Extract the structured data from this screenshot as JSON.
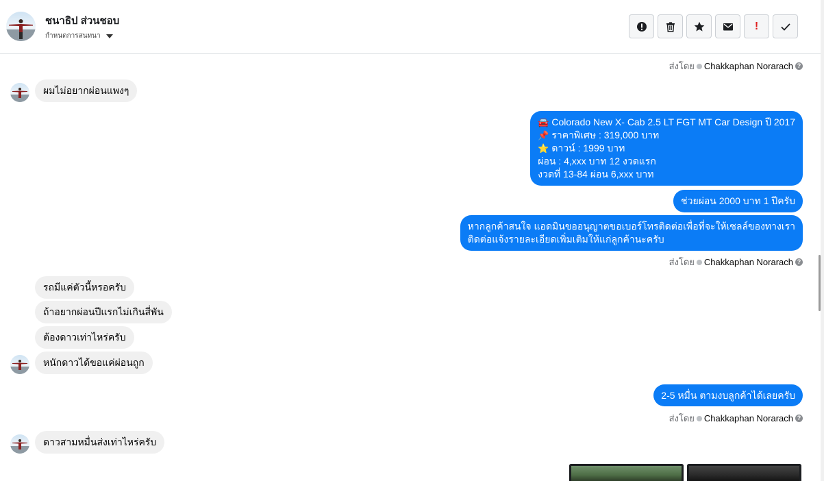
{
  "contact": {
    "name": "ชนาธิป ส่วนชอบ",
    "subtitle": "กำหนดการสนทนา"
  },
  "toolbar": [
    {
      "name": "report-spam-button",
      "icon": "alert-circle-icon"
    },
    {
      "name": "delete-button",
      "icon": "trash-icon"
    },
    {
      "name": "star-button",
      "icon": "star-icon"
    },
    {
      "name": "mark-unread-button",
      "icon": "envelope-icon"
    },
    {
      "name": "mark-important-button",
      "icon": "exclamation-icon",
      "label": "!"
    },
    {
      "name": "mark-done-button",
      "icon": "check-icon"
    }
  ],
  "sent_by": {
    "prefix": "ส่งโดย",
    "sender": "Chakkaphan Norarach",
    "help": "?"
  },
  "messages": {
    "m1": "ผมไม่อยากผ่อนแพงๆ",
    "m2": {
      "line1": "Colorado New X- Cab 2.5 LT FGT MT Car Design ปี 2017",
      "line2": "ราคาพิเศษ : 319,000 บาท",
      "line3": "ดาวน์ : 1999 บาท",
      "line4": "ผ่อน : 4,xxx บาท 12 งวดแรก",
      "line5": "งวดที่ 13-84 ผ่อน 6,xxx บาท",
      "emoji1": "🚘",
      "emoji2": "📌",
      "emoji3": "⭐"
    },
    "m3": "ช่วยผ่อน 2000 บาท 1 ปีครับ",
    "m4": {
      "line1": "หากลูกค้าสนใจ แอดมินขออนุญาตขอเบอร์โทรติดต่อเพื่อที่จะให้เซลล์ของทางเรา",
      "line2": "ติดต่อแจ้งรายละเอียดเพิ่มเติมให้แก่ลูกค้านะครับ"
    },
    "m5": "รถมีแค่ตัวนี้หรอครับ",
    "m6": "ถ้าอยากผ่อนปีแรกไม่เกินสี่พัน",
    "m7": "ต้องดาวเท่าไหร่ครับ",
    "m8": "หนักดาวได้ขอแค่ผ่อนถูก",
    "m9": "2-5 หมื่น ตามงบลูกค้าได้เลยครับ",
    "m10": "ดาวสามหมื่นส่งเท่าไหร่ครับ"
  },
  "colors": {
    "outgoing_bubble": "#0b7cf6",
    "incoming_bubble": "#f0f0f0",
    "important_red": "#e02020"
  }
}
